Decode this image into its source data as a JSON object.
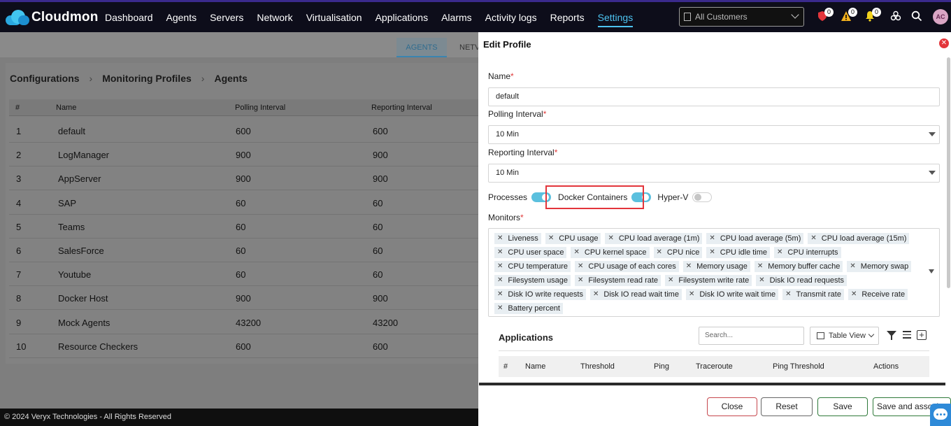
{
  "app": {
    "name": "Cloudmon"
  },
  "nav": [
    {
      "label": "Dashboard",
      "active": false
    },
    {
      "label": "Agents",
      "active": false
    },
    {
      "label": "Servers",
      "active": false
    },
    {
      "label": "Network",
      "active": false
    },
    {
      "label": "Virtualisation",
      "active": false
    },
    {
      "label": "Applications",
      "active": false
    },
    {
      "label": "Alarms",
      "active": false
    },
    {
      "label": "Activity logs",
      "active": false
    },
    {
      "label": "Reports",
      "active": false
    },
    {
      "label": "Settings",
      "active": true
    }
  ],
  "customer_select": {
    "value": "All Customers"
  },
  "badges": {
    "security": "0",
    "warnings": "0",
    "notifications": "0"
  },
  "user": {
    "initials": "AC"
  },
  "bg": {
    "tabs": [
      "AGENTS",
      "NETV"
    ],
    "breadcrumb": [
      "Configurations",
      "Monitoring Profiles",
      "Agents"
    ],
    "table": {
      "headers": [
        "#",
        "Name",
        "Polling Interval",
        "Reporting Interval"
      ],
      "rows": [
        [
          "1",
          "default",
          "600",
          "600"
        ],
        [
          "2",
          "LogManager",
          "900",
          "900"
        ],
        [
          "3",
          "AppServer",
          "900",
          "900"
        ],
        [
          "4",
          "SAP",
          "60",
          "60"
        ],
        [
          "5",
          "Teams",
          "60",
          "60"
        ],
        [
          "6",
          "SalesForce",
          "60",
          "60"
        ],
        [
          "7",
          "Youtube",
          "60",
          "60"
        ],
        [
          "8",
          "Docker Host",
          "900",
          "900"
        ],
        [
          "9",
          "Mock Agents",
          "43200",
          "43200"
        ],
        [
          "10",
          "Resource Checkers",
          "600",
          "600"
        ]
      ]
    }
  },
  "footer": {
    "text": "© 2024 Veryx Technologies - All Rights Reserved"
  },
  "drawer": {
    "title": "Edit Profile",
    "name_label": "Name",
    "name_value": "default",
    "polling_label": "Polling Interval",
    "polling_value": "10 Min",
    "reporting_label": "Reporting Interval",
    "reporting_value": "10 Min",
    "toggles": [
      {
        "label": "Processes",
        "on": true
      },
      {
        "label": "Docker Containers",
        "on": true
      },
      {
        "label": "Hyper-V",
        "on": false
      }
    ],
    "monitors_label": "Monitors",
    "monitors": [
      "Liveness",
      "CPU usage",
      "CPU load average (1m)",
      "CPU load average (5m)",
      "CPU load average (15m)",
      "CPU user space",
      "CPU kernel space",
      "CPU nice",
      "CPU idle time",
      "CPU interrupts",
      "CPU temperature",
      "CPU usage of each cores",
      "Memory usage",
      "Memory buffer cache",
      "Memory swap",
      "Filesystem usage",
      "Filesystem read rate",
      "Filesystem write rate",
      "Disk IO read requests",
      "Disk IO write requests",
      "Disk IO read wait time",
      "Disk IO write wait time",
      "Transmit rate",
      "Receive rate",
      "Battery percent"
    ],
    "applications": {
      "title": "Applications",
      "search_placeholder": "Search...",
      "view_label": "Table View",
      "headers": [
        "#",
        "Name",
        "Threshold",
        "Ping",
        "Traceroute",
        "Ping Threshold",
        "Actions"
      ]
    },
    "buttons": {
      "close": "Close",
      "reset": "Reset",
      "save": "Save",
      "save_associate": "Save and associate"
    }
  },
  "colors": {
    "accent": "#4dc3f0",
    "danger": "#e3353b",
    "toggle_on": "#5bc0de",
    "nav_bg": "#0d0d1a"
  }
}
